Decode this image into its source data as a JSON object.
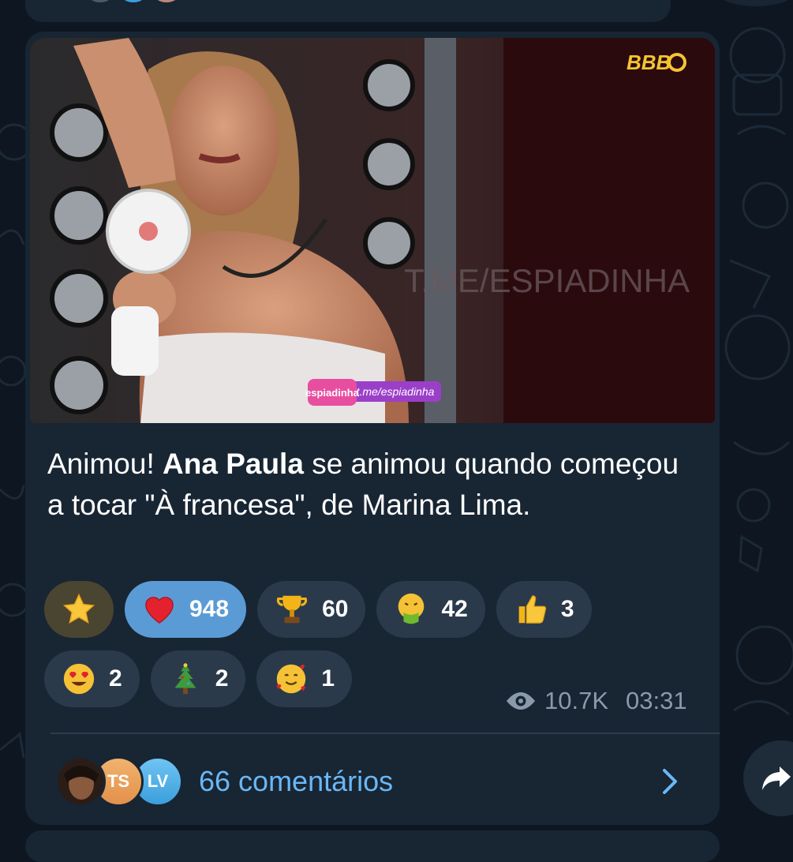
{
  "media": {
    "watermark_top": "BBB",
    "watermark_channel": "T.ME/ESPIADINHA",
    "badge_logo": "espiadinha",
    "badge_link": "t.me/espiadinha"
  },
  "caption": {
    "prefix": "Animou! ",
    "bold": "Ana Paula",
    "suffix": " se animou quando começou a tocar \"À francesa\", de Marina Lima."
  },
  "reactions": [
    {
      "emoji": "star-emoji",
      "count": ""
    },
    {
      "emoji": "red-heart-emoji",
      "count": "948",
      "selected": true
    },
    {
      "emoji": "trophy-emoji",
      "count": "60"
    },
    {
      "emoji": "vomiting-face-emoji",
      "count": "42"
    },
    {
      "emoji": "thumbs-up-emoji",
      "count": "3"
    },
    {
      "emoji": "heart-eyes-emoji",
      "count": "2"
    },
    {
      "emoji": "christmas-tree-emoji",
      "count": "2"
    },
    {
      "emoji": "smiling-face-hearts-emoji",
      "count": "1"
    }
  ],
  "meta": {
    "views": "10.7K",
    "time": "03:31"
  },
  "comments": {
    "avatars": [
      "",
      "TS",
      "LV"
    ],
    "label": "66 comentários"
  },
  "colors": {
    "bubble": "#182533",
    "background": "#0e1621",
    "accent": "#6ab7f5",
    "selected_reaction": "#5b9bd5"
  }
}
